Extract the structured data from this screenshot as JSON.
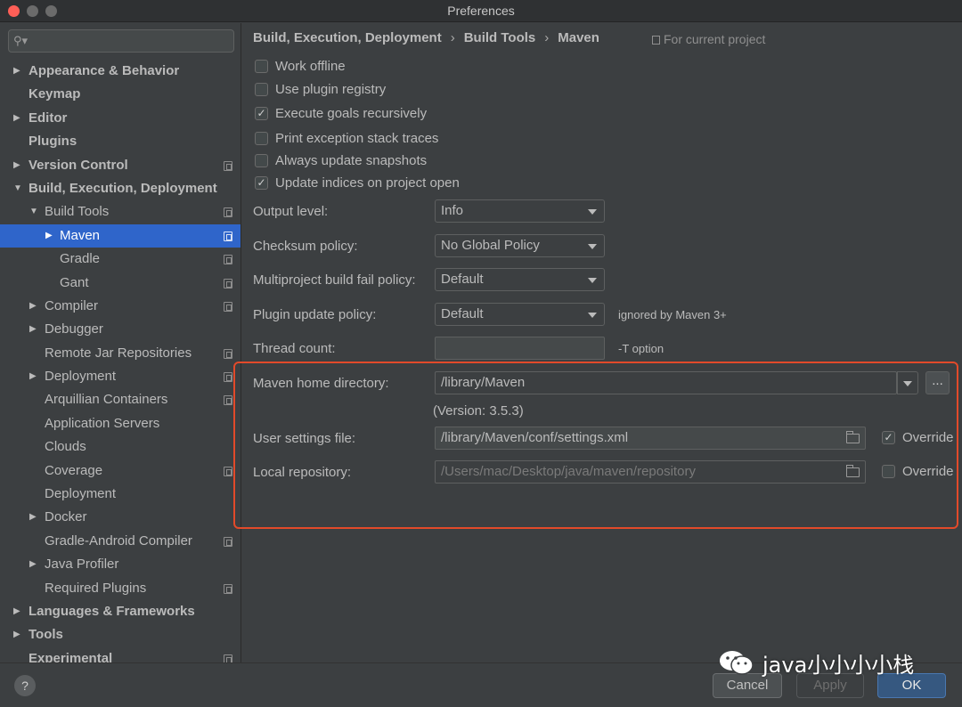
{
  "window": {
    "title": "Preferences"
  },
  "search": {
    "placeholder": ""
  },
  "sidebar": {
    "items": [
      {
        "label": "Appearance & Behavior",
        "arrow": "▶"
      },
      {
        "label": "Keymap"
      },
      {
        "label": "Editor",
        "arrow": "▶"
      },
      {
        "label": "Plugins"
      },
      {
        "label": "Version Control",
        "arrow": "▶"
      },
      {
        "label": "Build, Execution, Deployment",
        "arrow": "▼"
      },
      {
        "label": "Build Tools",
        "arrow": "▼"
      },
      {
        "label": "Maven",
        "arrow": "▶"
      },
      {
        "label": "Gradle"
      },
      {
        "label": "Gant"
      },
      {
        "label": "Compiler",
        "arrow": "▶"
      },
      {
        "label": "Debugger",
        "arrow": "▶"
      },
      {
        "label": "Remote Jar Repositories"
      },
      {
        "label": "Deployment",
        "arrow": "▶"
      },
      {
        "label": "Arquillian Containers"
      },
      {
        "label": "Application Servers"
      },
      {
        "label": "Clouds"
      },
      {
        "label": "Coverage"
      },
      {
        "label": "Deployment"
      },
      {
        "label": "Docker",
        "arrow": "▶"
      },
      {
        "label": "Gradle-Android Compiler"
      },
      {
        "label": "Java Profiler",
        "arrow": "▶"
      },
      {
        "label": "Required Plugins"
      },
      {
        "label": "Languages & Frameworks",
        "arrow": "▶"
      },
      {
        "label": "Tools",
        "arrow": "▶"
      },
      {
        "label": "Experimental"
      }
    ]
  },
  "breadcrumb": {
    "part1": "Build, Execution, Deployment",
    "part2": "Build Tools",
    "part3": "Maven",
    "separator": "›",
    "scope": "For current project"
  },
  "options": {
    "work_offline": {
      "label": "Work offline",
      "checked": false
    },
    "plugin_registry": {
      "label": "Use plugin registry",
      "checked": false
    },
    "recursive": {
      "label": "Execute goals recursively",
      "checked": true
    },
    "stack_traces": {
      "label": "Print exception stack traces",
      "checked": false
    },
    "update_snapshots": {
      "label": "Always update snapshots",
      "checked": false
    },
    "update_indices": {
      "label": "Update indices on project open",
      "checked": true
    }
  },
  "fields": {
    "output_level": {
      "label": "Output level:",
      "value": "Info"
    },
    "checksum_policy": {
      "label": "Checksum policy:",
      "value": "No Global Policy"
    },
    "fail_policy": {
      "label": "Multiproject build fail policy:",
      "value": "Default"
    },
    "plugin_update": {
      "label": "Plugin update policy:",
      "value": "Default",
      "hint": "ignored by Maven 3+"
    },
    "thread_count": {
      "label": "Thread count:",
      "value": "",
      "hint": "-T option"
    },
    "maven_home": {
      "label": "Maven home directory:",
      "value": "/library/Maven",
      "browse": "...",
      "version": "(Version: 3.5.3)"
    },
    "user_settings": {
      "label": "User settings file:",
      "value": "/library/Maven/conf/settings.xml",
      "override_label": "Override",
      "override": true
    },
    "local_repo": {
      "label": "Local repository:",
      "value": "/Users/mac/Desktop/java/maven/repository",
      "override_label": "Override",
      "override": false
    }
  },
  "buttons": {
    "help": "?",
    "cancel": "Cancel",
    "apply": "Apply",
    "ok": "OK"
  },
  "watermark": {
    "text": "java小小小小栈"
  },
  "colors": {
    "selection": "#2f65ca",
    "highlight_border": "#e24a2a",
    "ok_button": "#365880"
  }
}
